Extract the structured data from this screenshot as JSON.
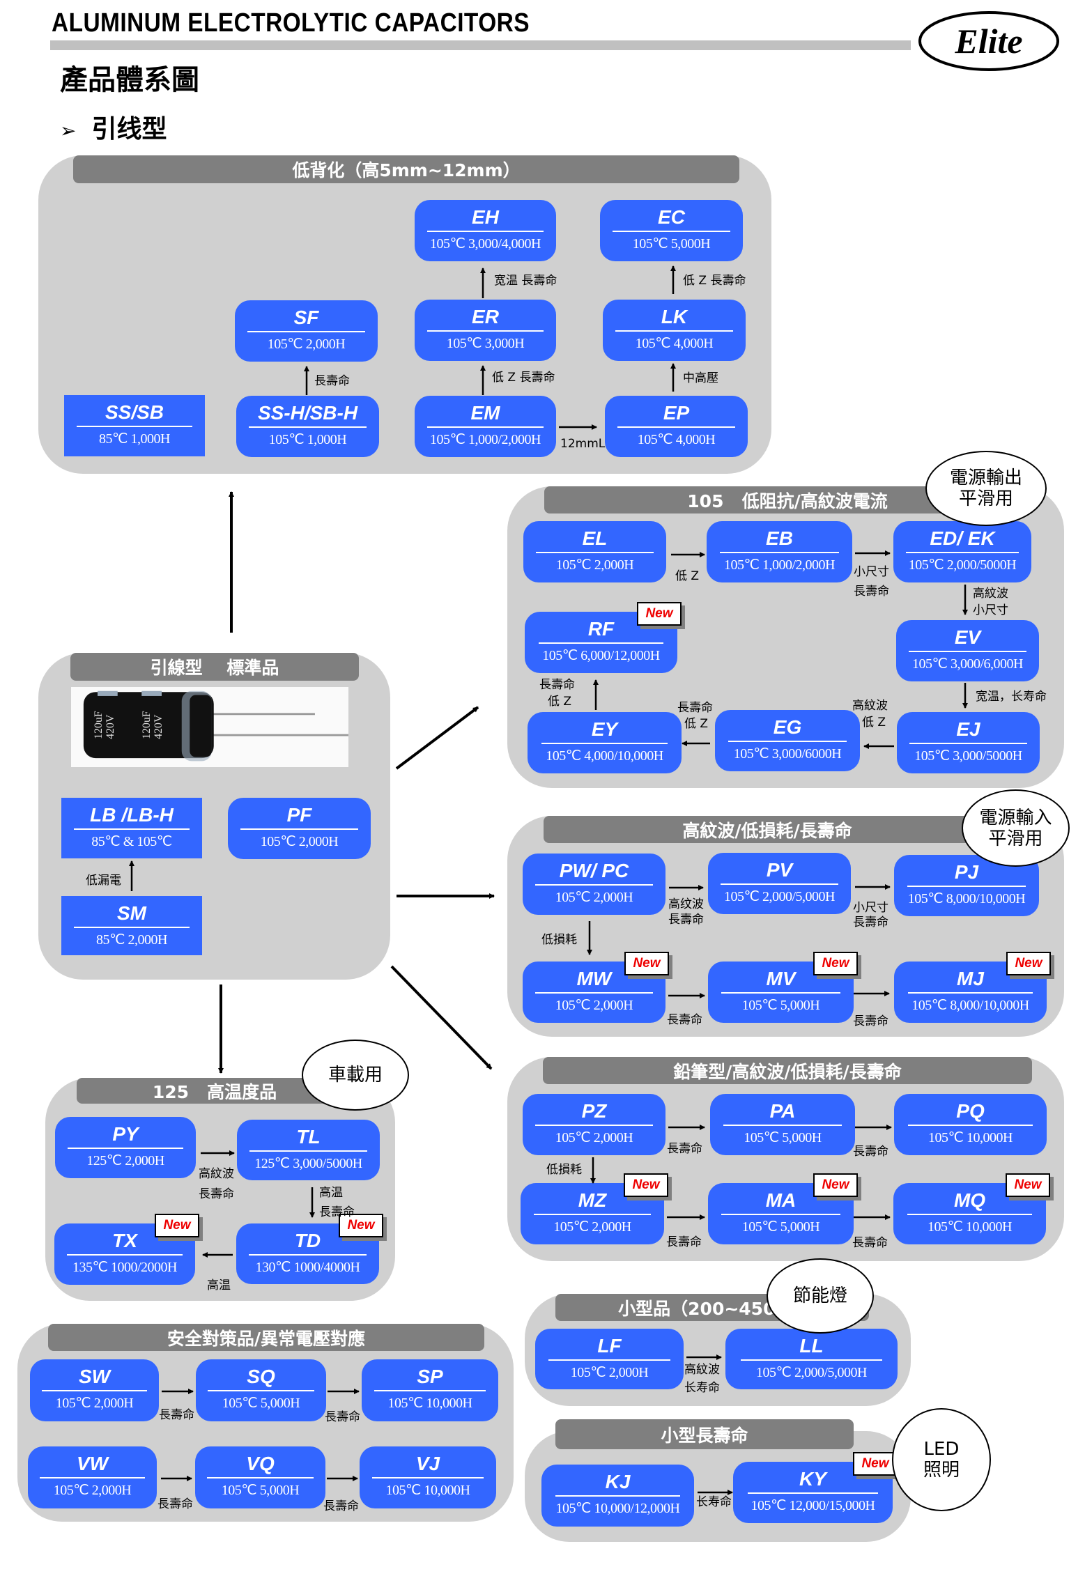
{
  "header": {
    "doc_title": "ALUMINUM ELECTROLYTIC CAPACITORS",
    "logo_text": "Elite",
    "page_title": "產品體系圖",
    "section_bullet": "➢",
    "section_title": "引线型"
  },
  "new_badge": "New",
  "colors": {
    "box": "#3366ff",
    "panel": "#d0d0d0",
    "panel_head": "#7f7f7f",
    "new_text": "#e00000"
  },
  "panels": {
    "low_profile": {
      "title": "低背化（高5mm~12mm）",
      "boxes": {
        "ss_sb": {
          "name": "SS/SB",
          "spec": "85℃  1,000H"
        },
        "ssh_sbh": {
          "name": "SS-H/SB-H",
          "spec": "105℃  1,000H"
        },
        "sf": {
          "name": "SF",
          "spec": "105℃  2,000H"
        },
        "em": {
          "name": "EM",
          "spec": "105℃  1,000/2,000H"
        },
        "er": {
          "name": "ER",
          "spec": "105℃  3,000H"
        },
        "eh": {
          "name": "EH",
          "spec": "105℃  3,000/4,000H"
        },
        "ep": {
          "name": "EP",
          "spec": "105℃  4,000H"
        },
        "lk": {
          "name": "LK",
          "spec": "105℃  4,000H"
        },
        "ec": {
          "name": "EC",
          "spec": "105℃  5,000H"
        }
      },
      "labels": {
        "ssh_to_sf": "長壽命",
        "em_to_er": "低 Z 長壽命",
        "er_to_eh": "宽温  長壽命",
        "em_to_ep": "12mmL",
        "ep_to_lk": "中高壓",
        "lk_to_ec": "低 Z 長壽命"
      }
    },
    "standard": {
      "title": "引線型    標準品",
      "photo_caption": "Elite 120uF 420V",
      "boxes": {
        "lb": {
          "name": "LB /LB-H",
          "spec": "85℃  & 105℃"
        },
        "pf": {
          "name": "PF",
          "spec": "105℃  2,000H"
        },
        "sm": {
          "name": "SM",
          "spec": "85℃  2,000H"
        }
      },
      "labels": {
        "sm_to_lb": "低漏電"
      }
    },
    "low_impedance": {
      "title": "105   低阻抗/高紋波電流",
      "bubble": "電源輸出\n平滑用",
      "boxes": {
        "el": {
          "name": "EL",
          "spec": "105℃  2,000H"
        },
        "eb": {
          "name": "EB",
          "spec": "105℃  1,000/2,000H"
        },
        "ed": {
          "name": "ED/ EK",
          "spec": "105℃  2,000/5000H"
        },
        "rf": {
          "name": "RF",
          "spec": "105℃  6,000/12,000H",
          "new": true
        },
        "ev": {
          "name": "EV",
          "spec": "105℃  3,000/6,000H"
        },
        "ey": {
          "name": "EY",
          "spec": "105℃  4,000/10,000H"
        },
        "eg": {
          "name": "EG",
          "spec": "105℃  3,000/6000H"
        },
        "ej": {
          "name": "EJ",
          "spec": "105℃  3,000/5000H"
        }
      },
      "labels": {
        "el_to_eb": "低 Z",
        "eb_to_ed_1": "小尺寸",
        "eb_to_ed_2": "長壽命",
        "ed_to_ev_1": "高紋波",
        "ed_to_ev_2": "小尺寸",
        "ev_to_ej": "宽温，长寿命",
        "ej_to_eg_1": "高紋波",
        "ej_to_eg_2": "低 Z",
        "eg_to_ey_1": "長壽命",
        "eg_to_ey_2": "低 Z",
        "ey_to_rf_1": "長壽命",
        "ey_to_rf_2": "低 Z"
      }
    },
    "high_ripple": {
      "title": "高紋波/低損耗/長壽命",
      "bubble": "電源輸入\n平滑用",
      "boxes": {
        "pw": {
          "name": "PW/ PC",
          "spec": "105℃  2,000H"
        },
        "pv": {
          "name": "PV",
          "spec": "105℃  2,000/5,000H"
        },
        "pj": {
          "name": "PJ",
          "spec": "105℃  8,000/10,000H"
        },
        "mw": {
          "name": "MW",
          "spec": "105℃  2,000H",
          "new": true
        },
        "mv": {
          "name": "MV",
          "spec": "105℃  5,000H",
          "new": true
        },
        "mj": {
          "name": "MJ",
          "spec": "105℃  8,000/10,000H",
          "new": true
        }
      },
      "labels": {
        "pw_to_pv_1": "高纹波",
        "pw_to_pv_2": "長壽命",
        "pv_to_pj_1": "小尺寸",
        "pv_to_pj_2": "長壽命",
        "pw_to_mw": "低損耗",
        "mw_to_mv": "長壽命",
        "mv_to_mj": "長壽命"
      }
    },
    "pencil": {
      "title": "鉛筆型/高紋波/低損耗/長壽命",
      "boxes": {
        "pz": {
          "name": "PZ",
          "spec": "105℃  2,000H"
        },
        "pa": {
          "name": "PA",
          "spec": "105℃  5,000H"
        },
        "pq": {
          "name": "PQ",
          "spec": "105℃  10,000H"
        },
        "mz": {
          "name": "MZ",
          "spec": "105℃  2,000H",
          "new": true
        },
        "ma": {
          "name": "MA",
          "spec": "105℃  5,000H",
          "new": true
        },
        "mq": {
          "name": "MQ",
          "spec": "105℃  10,000H",
          "new": true
        }
      },
      "labels": {
        "pz_to_pa": "長壽命",
        "pa_to_pq": "長壽命",
        "pz_to_mz": "低損耗",
        "mz_to_ma": "長壽命",
        "ma_to_mq": "長壽命"
      }
    },
    "high_temp": {
      "title": "125   高温度品",
      "bubble": "車載用",
      "boxes": {
        "py": {
          "name": "PY",
          "spec": "125℃  2,000H"
        },
        "tl": {
          "name": "TL",
          "spec": "125℃  3,000/5000H"
        },
        "tx": {
          "name": "TX",
          "spec": "135℃  1000/2000H",
          "new": true
        },
        "td": {
          "name": "TD",
          "spec": "130℃  1000/4000H",
          "new": true
        }
      },
      "labels": {
        "py_to_tl_1": "高紋波",
        "py_to_tl_2": "長壽命",
        "tl_to_td_1": "高温",
        "tl_to_td_2": "長壽命",
        "td_to_tx": "高温"
      }
    },
    "safety": {
      "title": "安全對策品/異常電壓對應",
      "boxes": {
        "sw": {
          "name": "SW",
          "spec": "105℃  2,000H"
        },
        "sq": {
          "name": "SQ",
          "spec": "105℃  5,000H"
        },
        "sp": {
          "name": "SP",
          "spec": "105℃  10,000H"
        },
        "vw": {
          "name": "VW",
          "spec": "105℃  2,000H"
        },
        "vq": {
          "name": "VQ",
          "spec": "105℃  5,000H"
        },
        "vj": {
          "name": "VJ",
          "spec": "105℃  10,000H"
        }
      },
      "labels": {
        "sw_to_sq": "長壽命",
        "sq_to_sp": "長壽命",
        "vw_to_vq": "長壽命",
        "vq_to_vj": "長壽命"
      }
    },
    "small": {
      "title": "小型品（200~450V）",
      "bubble": "節能燈",
      "boxes": {
        "lf": {
          "name": "LF",
          "spec": "105℃  2,000H"
        },
        "ll": {
          "name": "LL",
          "spec": "105℃  2,000/5,000H"
        }
      },
      "labels": {
        "lf_to_ll_1": "高紋波",
        "lf_to_ll_2": "长寿命"
      }
    },
    "small_long": {
      "title": "小型長壽命",
      "bubble": "LED\n照明",
      "boxes": {
        "kj": {
          "name": "KJ",
          "spec": "105℃  10,000/12,000H"
        },
        "ky": {
          "name": "KY",
          "spec": "105℃  12,000/15,000H",
          "new": true
        }
      },
      "labels": {
        "kj_to_ky": "长寿命"
      }
    }
  }
}
